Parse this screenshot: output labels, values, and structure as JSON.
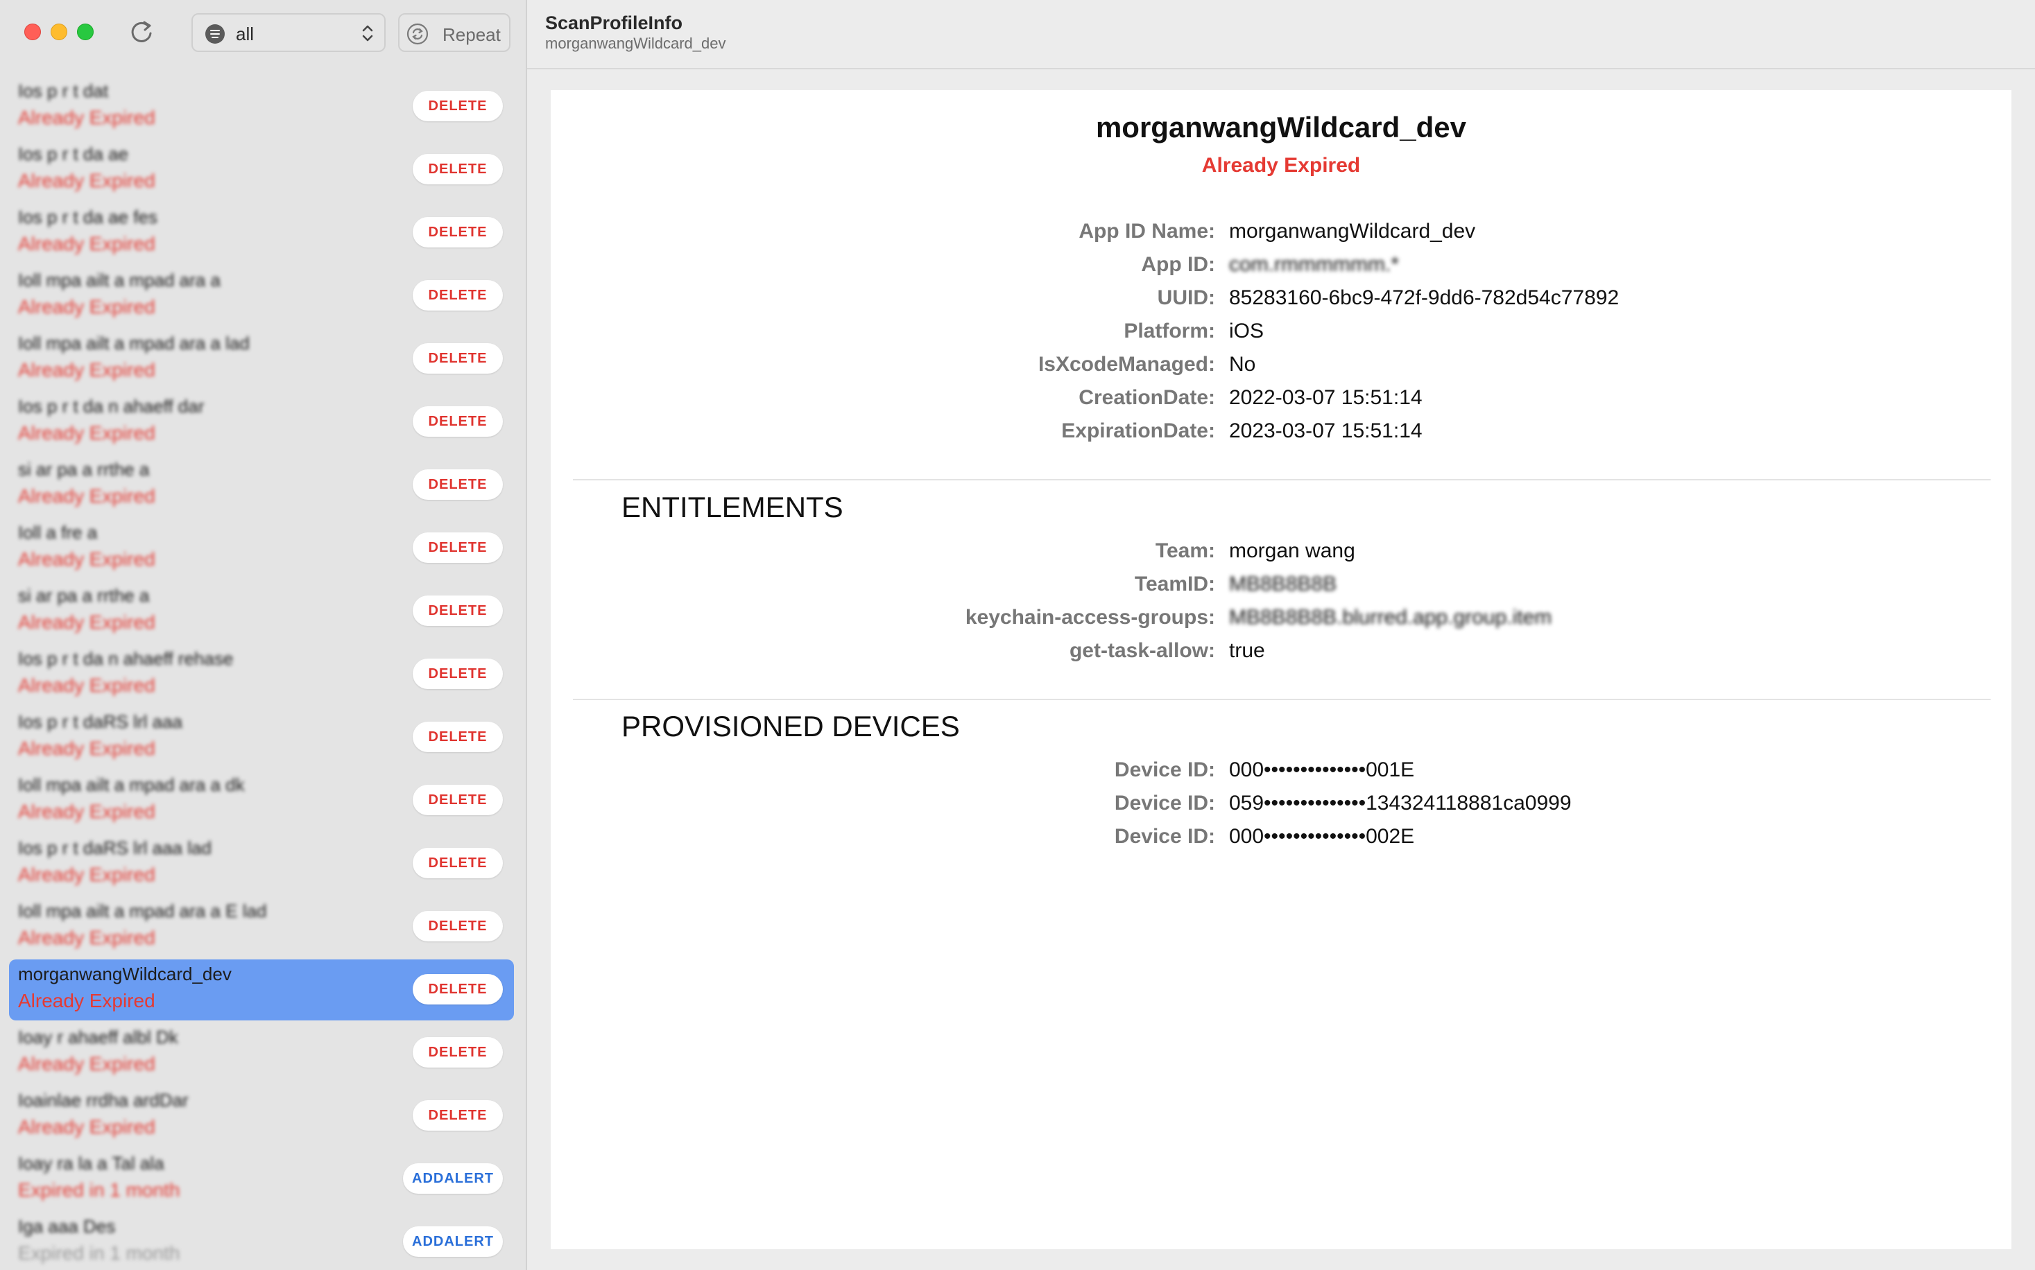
{
  "sidebar": {
    "toolbar": {
      "filter": {
        "value": "all"
      },
      "repeat_label": "Repeat"
    },
    "items": [
      {
        "name": "Ios p r t dat",
        "status": "Already Expired",
        "action": "DELETE"
      },
      {
        "name": "Ios p r t da ae",
        "status": "Already Expired",
        "action": "DELETE"
      },
      {
        "name": "Ios p r t da ae fes",
        "status": "Already Expired",
        "action": "DELETE"
      },
      {
        "name": "Ioll mpa ailt a mpad ara a",
        "status": "Already Expired",
        "action": "DELETE"
      },
      {
        "name": "Ioll mpa ailt a mpad ara a lad",
        "status": "Already Expired",
        "action": "DELETE"
      },
      {
        "name": "Ios p r t da n ahaeff dar",
        "status": "Already Expired",
        "action": "DELETE"
      },
      {
        "name": "si ar pa a rrthe a",
        "status": "Already Expired",
        "action": "DELETE"
      },
      {
        "name": "Ioll a fre a",
        "status": "Already Expired",
        "action": "DELETE"
      },
      {
        "name": "si ar pa a rrthe a",
        "status": "Already Expired",
        "action": "DELETE"
      },
      {
        "name": "Ios p r t da n ahaeff rehase",
        "status": "Already Expired",
        "action": "DELETE"
      },
      {
        "name": "Ios p r t daRS lrl aaa",
        "status": "Already Expired",
        "action": "DELETE"
      },
      {
        "name": "Ioll mpa ailt a mpad ara a dk",
        "status": "Already Expired",
        "action": "DELETE"
      },
      {
        "name": "Ios p r t daRS lrl aaa lad",
        "status": "Already Expired",
        "action": "DELETE"
      },
      {
        "name": "Ioll mpa ailt a mpad ara a E lad",
        "status": "Already Expired",
        "action": "DELETE"
      },
      {
        "name": "morganwangWildcard_dev",
        "status": "Already Expired",
        "action": "DELETE",
        "selected": true
      },
      {
        "name": "Ioay r ahaeff albl Dk",
        "status": "Already Expired",
        "action": "DELETE"
      },
      {
        "name": "Ioainlae rrdha ardDar",
        "status": "Already Expired",
        "action": "DELETE"
      },
      {
        "name": "Ioay ra la a Tal ala",
        "status": "Expired in 1 month",
        "action": "ADDALERT"
      },
      {
        "name": "Iga aaa Des",
        "status": "Expired in 1 month",
        "action": "ADDALERT",
        "status_grey": true
      }
    ]
  },
  "header": {
    "title": "ScanProfileInfo",
    "subtitle": "morganwangWildcard_dev"
  },
  "detail": {
    "name": "morganwangWildcard_dev",
    "status": "Already Expired",
    "fields": [
      {
        "key": "App ID Name:",
        "value": "morganwangWildcard_dev"
      },
      {
        "key": "App ID:",
        "value": "com.rmmmmmm.*",
        "redacted": true
      },
      {
        "key": "UUID:",
        "value": "85283160-6bc9-472f-9dd6-782d54c77892"
      },
      {
        "key": "Platform:",
        "value": "iOS"
      },
      {
        "key": "IsXcodeManaged:",
        "value": "No"
      },
      {
        "key": "CreationDate:",
        "value": "2022-03-07 15:51:14"
      },
      {
        "key": "ExpirationDate:",
        "value": "2023-03-07 15:51:14"
      }
    ],
    "entitlements": {
      "title": "ENTITLEMENTS",
      "fields": [
        {
          "key": "Team:",
          "value": "morgan wang"
        },
        {
          "key": "TeamID:",
          "value": "MB8B8B8B",
          "redacted": true
        },
        {
          "key": "keychain-access-groups:",
          "value": "MB8B8B8B.blurred.app.group.item",
          "redacted": true
        },
        {
          "key": "get-task-allow:",
          "value": "true"
        }
      ]
    },
    "devices": {
      "title": "PROVISIONED DEVICES",
      "fields": [
        {
          "key": "Device ID:",
          "value": "000••••••••••••••001E"
        },
        {
          "key": "Device ID:",
          "value": "059••••••••••••••134324118881ca0999"
        },
        {
          "key": "Device ID:",
          "value": "000••••••••••••••002E"
        }
      ]
    }
  }
}
